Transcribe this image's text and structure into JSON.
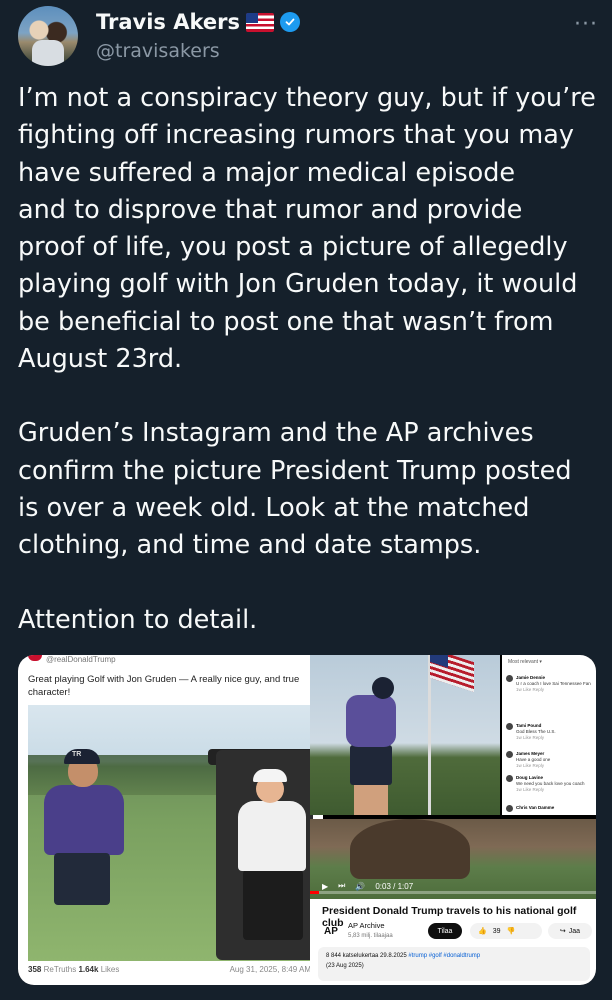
{
  "author": {
    "name": "Travis Akers",
    "handle": "@travisakers",
    "flag_emoji_label": "🇺🇸",
    "verified": true
  },
  "more_label": "···",
  "tweet": {
    "paragraph1": "I’m not a conspiracy theory guy, but if you’re\nfighting off increasing rumors that you may\nhave suffered a major medical episode\nand to disprove that rumor and provide\nproof of life, you post a picture of allegedly\nplaying golf with Jon Gruden today, it would\nbe beneficial to post one that wasn’t from\nAugust 23rd.",
    "paragraph2": "Gruden’s Instagram and the AP archives\nconfirm the picture President Trump posted\nis over a week old. Look at the matched\nclothing, and time and date stamps.",
    "paragraph3": "Attention to detail."
  },
  "truth_post": {
    "username": "@realDonaldTrump",
    "text": "Great playing Golf with Jon Gruden — A really nice guy, and true character!",
    "retruths_count": "358",
    "retruths_label": "ReTruths",
    "likes_count": "1.64k",
    "likes_label": "Likes",
    "date": "Aug 31, 2025, 8:49 AM",
    "cap_text": "TR"
  },
  "comments_panel": {
    "header": "Most relevant ▾",
    "items": [
      {
        "name": "Jamie Dennie",
        "text": "U r a coach I love Sai Tennessee Fan",
        "meta": "1w  Like  Reply"
      },
      {
        "name": "Tami Pound",
        "text": "God Bless The U.S.",
        "meta": "1w  Like  Reply"
      },
      {
        "name": "James Meyer",
        "text": "Have a good one",
        "meta": "1w  Like  Reply"
      },
      {
        "name": "Doug Lavine",
        "text": "We need you back love you coach",
        "meta": "1w  Like  Reply"
      },
      {
        "name": "Chris Van Damme",
        "text": "",
        "meta": ""
      }
    ]
  },
  "ap_video": {
    "time": "0:03 / 1:07",
    "progress_fraction": 0.03,
    "title": "President Donald Trump travels to his national golf club",
    "logo": "AP",
    "channel": "AP Archive",
    "subscribers": "5,83 milj. tilaajaa",
    "subscribe_label": "Tilaa",
    "likes": "39",
    "share_label": "Jaa",
    "views_date": "8 844 katselukertaa  29.8.2025",
    "hashtags": "#trump #golf #donaldtrump",
    "upload_note": "(23 Aug 2025)"
  },
  "colors": {
    "background": "#15202b",
    "text": "#f7f9f9",
    "muted": "#8b98a5",
    "verified_blue": "#1d9bf0"
  }
}
